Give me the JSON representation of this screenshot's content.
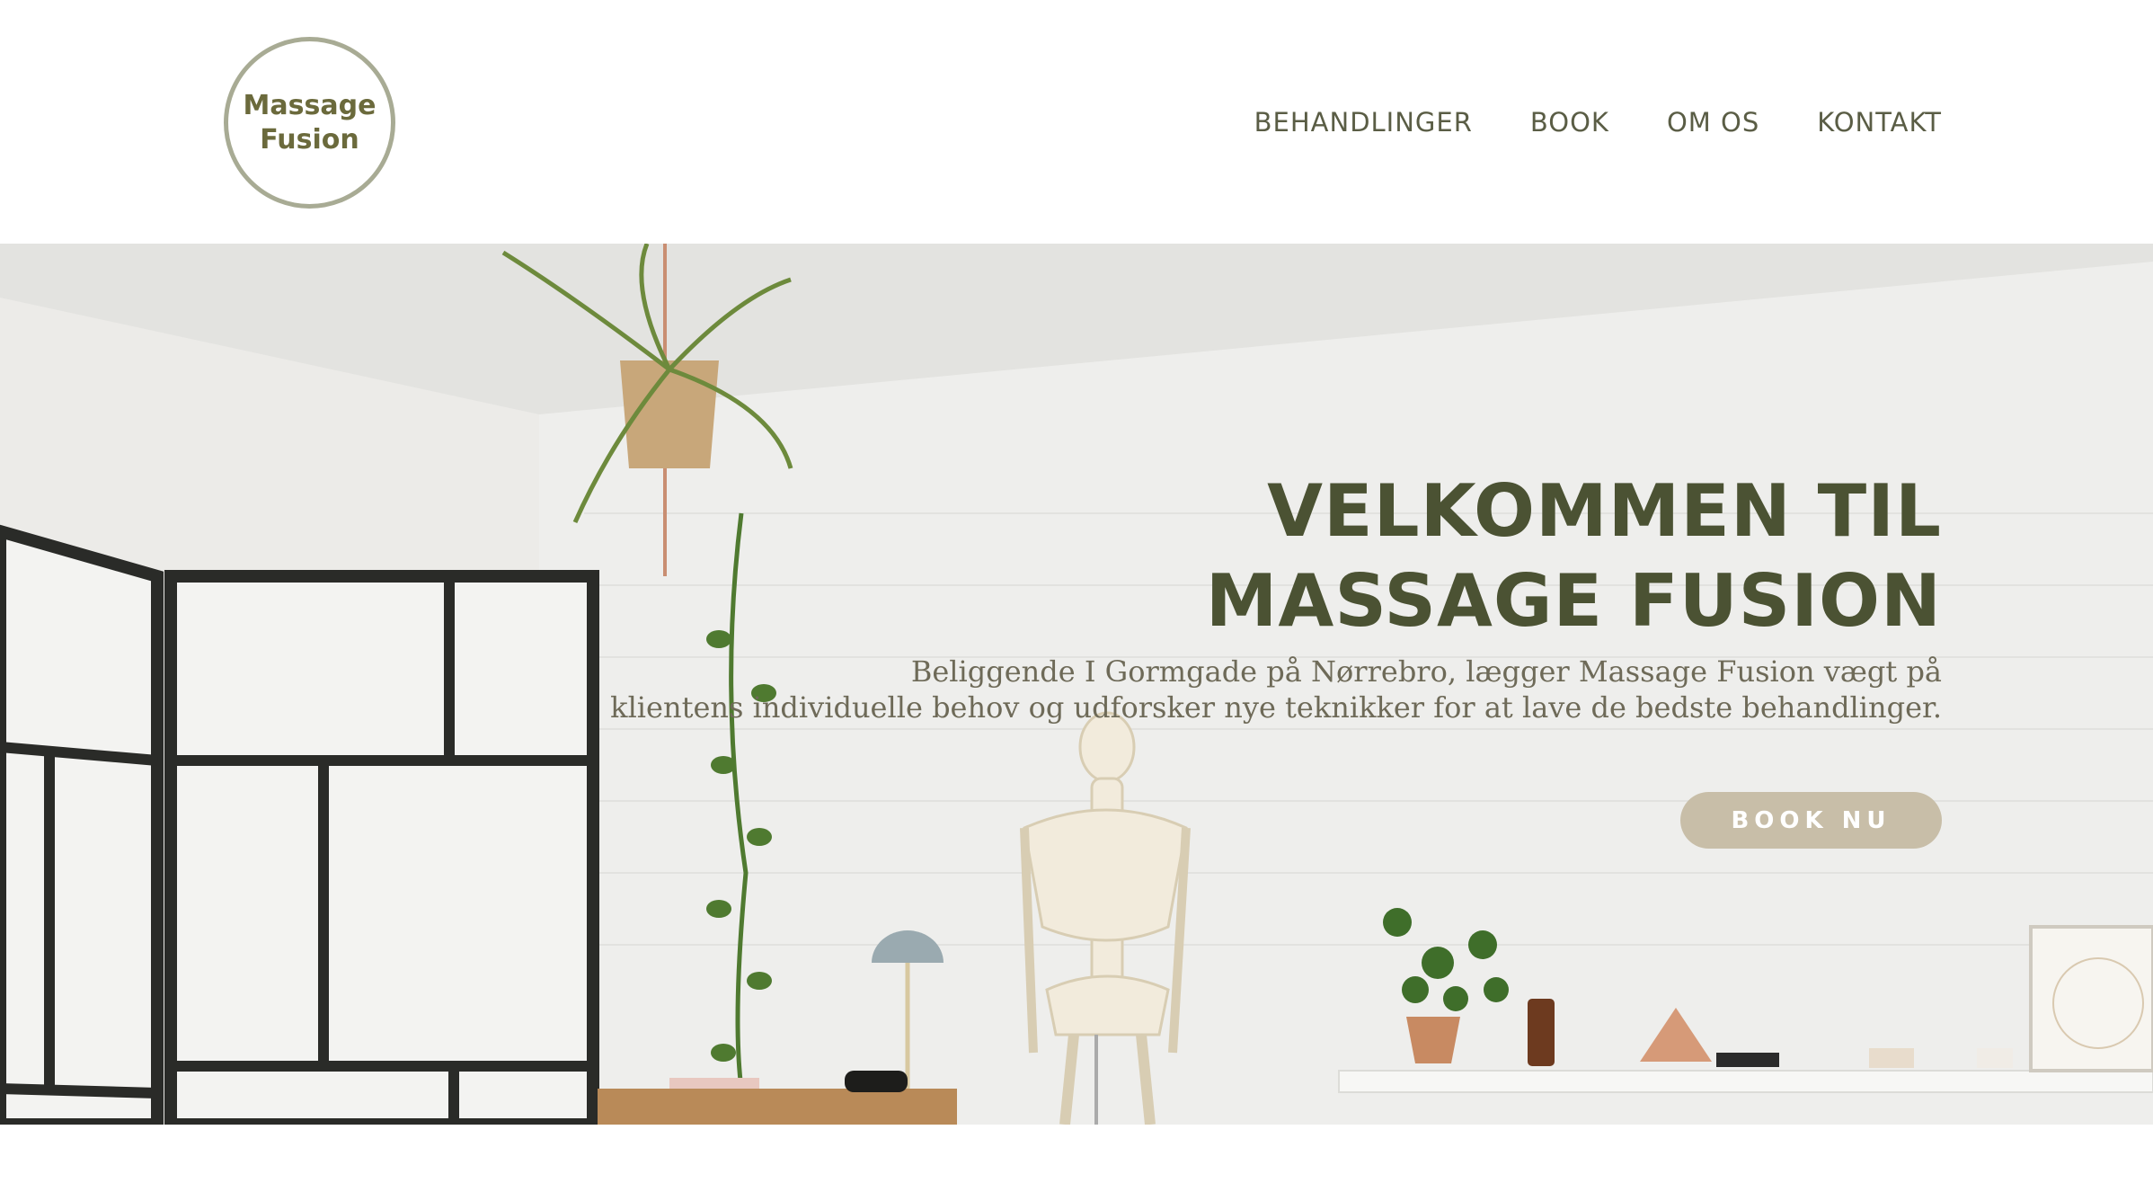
{
  "logo": {
    "line1": "Massage",
    "line2": "Fusion"
  },
  "nav": {
    "items": [
      "BEHANDLINGER",
      "BOOK",
      "OM OS",
      "KONTAKT"
    ]
  },
  "hero": {
    "title_line1": "VELKOMMEN TIL",
    "title_line2": "MASSAGE FUSION",
    "subtitle_line1": "Beliggende I Gormgade på Nørrebro, lægger Massage Fusion vægt på",
    "subtitle_line2": "klientens individuelle behov og udforsker nye teknikker for at lave de bedste behandlinger.",
    "cta_label": "BOOK NU"
  },
  "colors": {
    "brand_olive": "#4b5233",
    "nav_text": "#5a5d45",
    "button_bg": "#c8bea8",
    "logo_ring": "#a8ab94"
  },
  "icons": {
    "hero_scene": "massage-room-photo"
  }
}
